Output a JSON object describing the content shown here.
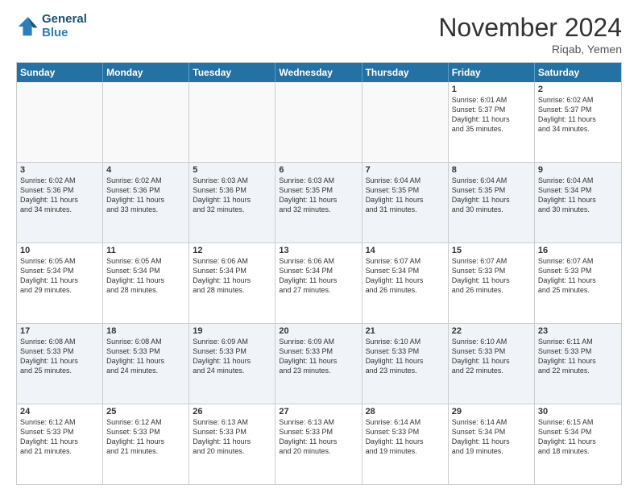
{
  "header": {
    "logo_line1": "General",
    "logo_line2": "Blue",
    "month": "November 2024",
    "location": "Riqab, Yemen"
  },
  "days_of_week": [
    "Sunday",
    "Monday",
    "Tuesday",
    "Wednesday",
    "Thursday",
    "Friday",
    "Saturday"
  ],
  "rows": [
    [
      {
        "day": "",
        "text": ""
      },
      {
        "day": "",
        "text": ""
      },
      {
        "day": "",
        "text": ""
      },
      {
        "day": "",
        "text": ""
      },
      {
        "day": "",
        "text": ""
      },
      {
        "day": "1",
        "text": "Sunrise: 6:01 AM\nSunset: 5:37 PM\nDaylight: 11 hours\nand 35 minutes."
      },
      {
        "day": "2",
        "text": "Sunrise: 6:02 AM\nSunset: 5:37 PM\nDaylight: 11 hours\nand 34 minutes."
      }
    ],
    [
      {
        "day": "3",
        "text": "Sunrise: 6:02 AM\nSunset: 5:36 PM\nDaylight: 11 hours\nand 34 minutes."
      },
      {
        "day": "4",
        "text": "Sunrise: 6:02 AM\nSunset: 5:36 PM\nDaylight: 11 hours\nand 33 minutes."
      },
      {
        "day": "5",
        "text": "Sunrise: 6:03 AM\nSunset: 5:36 PM\nDaylight: 11 hours\nand 32 minutes."
      },
      {
        "day": "6",
        "text": "Sunrise: 6:03 AM\nSunset: 5:35 PM\nDaylight: 11 hours\nand 32 minutes."
      },
      {
        "day": "7",
        "text": "Sunrise: 6:04 AM\nSunset: 5:35 PM\nDaylight: 11 hours\nand 31 minutes."
      },
      {
        "day": "8",
        "text": "Sunrise: 6:04 AM\nSunset: 5:35 PM\nDaylight: 11 hours\nand 30 minutes."
      },
      {
        "day": "9",
        "text": "Sunrise: 6:04 AM\nSunset: 5:34 PM\nDaylight: 11 hours\nand 30 minutes."
      }
    ],
    [
      {
        "day": "10",
        "text": "Sunrise: 6:05 AM\nSunset: 5:34 PM\nDaylight: 11 hours\nand 29 minutes."
      },
      {
        "day": "11",
        "text": "Sunrise: 6:05 AM\nSunset: 5:34 PM\nDaylight: 11 hours\nand 28 minutes."
      },
      {
        "day": "12",
        "text": "Sunrise: 6:06 AM\nSunset: 5:34 PM\nDaylight: 11 hours\nand 28 minutes."
      },
      {
        "day": "13",
        "text": "Sunrise: 6:06 AM\nSunset: 5:34 PM\nDaylight: 11 hours\nand 27 minutes."
      },
      {
        "day": "14",
        "text": "Sunrise: 6:07 AM\nSunset: 5:34 PM\nDaylight: 11 hours\nand 26 minutes."
      },
      {
        "day": "15",
        "text": "Sunrise: 6:07 AM\nSunset: 5:33 PM\nDaylight: 11 hours\nand 26 minutes."
      },
      {
        "day": "16",
        "text": "Sunrise: 6:07 AM\nSunset: 5:33 PM\nDaylight: 11 hours\nand 25 minutes."
      }
    ],
    [
      {
        "day": "17",
        "text": "Sunrise: 6:08 AM\nSunset: 5:33 PM\nDaylight: 11 hours\nand 25 minutes."
      },
      {
        "day": "18",
        "text": "Sunrise: 6:08 AM\nSunset: 5:33 PM\nDaylight: 11 hours\nand 24 minutes."
      },
      {
        "day": "19",
        "text": "Sunrise: 6:09 AM\nSunset: 5:33 PM\nDaylight: 11 hours\nand 24 minutes."
      },
      {
        "day": "20",
        "text": "Sunrise: 6:09 AM\nSunset: 5:33 PM\nDaylight: 11 hours\nand 23 minutes."
      },
      {
        "day": "21",
        "text": "Sunrise: 6:10 AM\nSunset: 5:33 PM\nDaylight: 11 hours\nand 23 minutes."
      },
      {
        "day": "22",
        "text": "Sunrise: 6:10 AM\nSunset: 5:33 PM\nDaylight: 11 hours\nand 22 minutes."
      },
      {
        "day": "23",
        "text": "Sunrise: 6:11 AM\nSunset: 5:33 PM\nDaylight: 11 hours\nand 22 minutes."
      }
    ],
    [
      {
        "day": "24",
        "text": "Sunrise: 6:12 AM\nSunset: 5:33 PM\nDaylight: 11 hours\nand 21 minutes."
      },
      {
        "day": "25",
        "text": "Sunrise: 6:12 AM\nSunset: 5:33 PM\nDaylight: 11 hours\nand 21 minutes."
      },
      {
        "day": "26",
        "text": "Sunrise: 6:13 AM\nSunset: 5:33 PM\nDaylight: 11 hours\nand 20 minutes."
      },
      {
        "day": "27",
        "text": "Sunrise: 6:13 AM\nSunset: 5:33 PM\nDaylight: 11 hours\nand 20 minutes."
      },
      {
        "day": "28",
        "text": "Sunrise: 6:14 AM\nSunset: 5:33 PM\nDaylight: 11 hours\nand 19 minutes."
      },
      {
        "day": "29",
        "text": "Sunrise: 6:14 AM\nSunset: 5:34 PM\nDaylight: 11 hours\nand 19 minutes."
      },
      {
        "day": "30",
        "text": "Sunrise: 6:15 AM\nSunset: 5:34 PM\nDaylight: 11 hours\nand 18 minutes."
      }
    ]
  ]
}
